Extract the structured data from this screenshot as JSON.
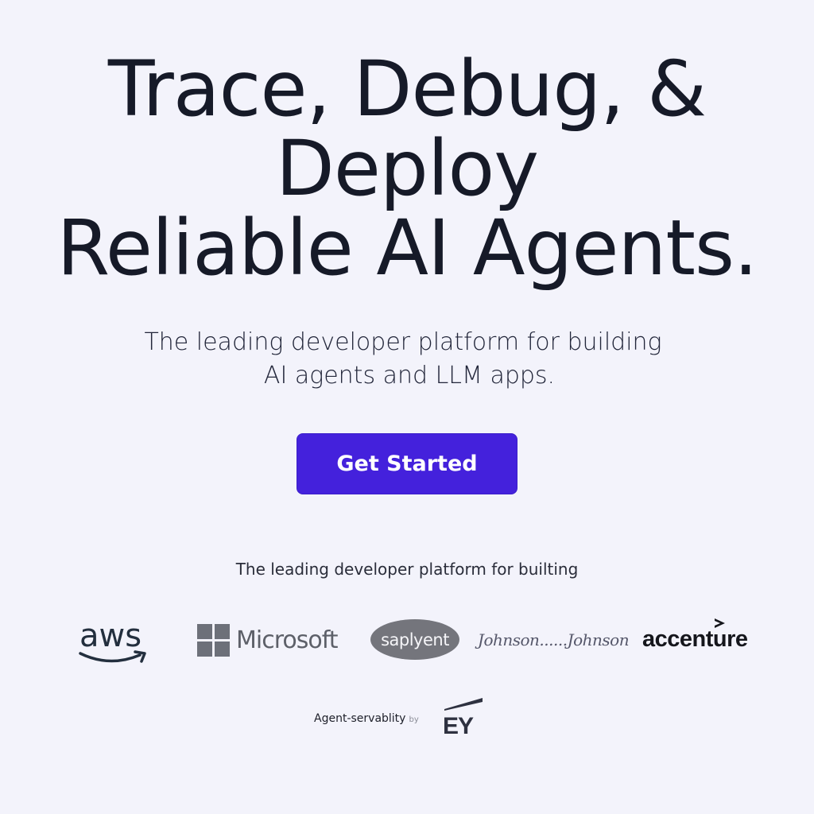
{
  "hero": {
    "title_line1": "Trace, Debug, &",
    "title_line2": "Deploy",
    "title_line3": "Reliable AI Agents.",
    "subtitle_line1": "The leading developer platform for building",
    "subtitle_line2": "AI agents and LLM apps."
  },
  "cta": {
    "label": "Get Started",
    "color": "#4421dc"
  },
  "trusted": {
    "caption": "The leading developer platform for builting",
    "logos": [
      {
        "name": "aws",
        "text": "aws",
        "icon": "aws-smile-icon"
      },
      {
        "name": "microsoft",
        "text": "Microsoft",
        "icon": "windows-grid-icon"
      },
      {
        "name": "saplyent",
        "text": "saplyent"
      },
      {
        "name": "johnson-and-johnson",
        "text": "Johnson......Johnson"
      },
      {
        "name": "accenture",
        "text": "accenture",
        "icon": "accenture-chevron-icon"
      }
    ],
    "footer_text": "Agent-servablity",
    "footer_by": "by",
    "ey_text": "EY"
  },
  "colors": {
    "background": "#f3f3fb",
    "heading": "#161a28",
    "button": "#4421dc"
  }
}
